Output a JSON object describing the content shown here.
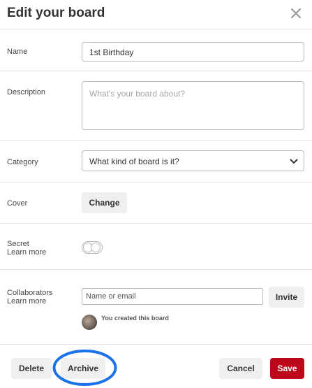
{
  "dialog": {
    "title": "Edit your board"
  },
  "fields": {
    "name": {
      "label": "Name",
      "value": "1st Birthday"
    },
    "description": {
      "label": "Description",
      "placeholder": "What's your board about?"
    },
    "category": {
      "label": "Category",
      "selected": "What kind of board is it?"
    },
    "cover": {
      "label": "Cover",
      "button": "Change"
    },
    "secret": {
      "label": "Secret",
      "learn_more": "Learn more",
      "enabled": false
    },
    "collaborators": {
      "label": "Collaborators",
      "learn_more": "Learn more",
      "placeholder": "Name or email",
      "invite_button": "Invite",
      "created_note": "You created this board"
    }
  },
  "footer": {
    "delete": "Delete",
    "archive": "Archive",
    "cancel": "Cancel",
    "save": "Save"
  },
  "colors": {
    "save": "#bd081c",
    "highlight_circle": "#1a73e8"
  }
}
